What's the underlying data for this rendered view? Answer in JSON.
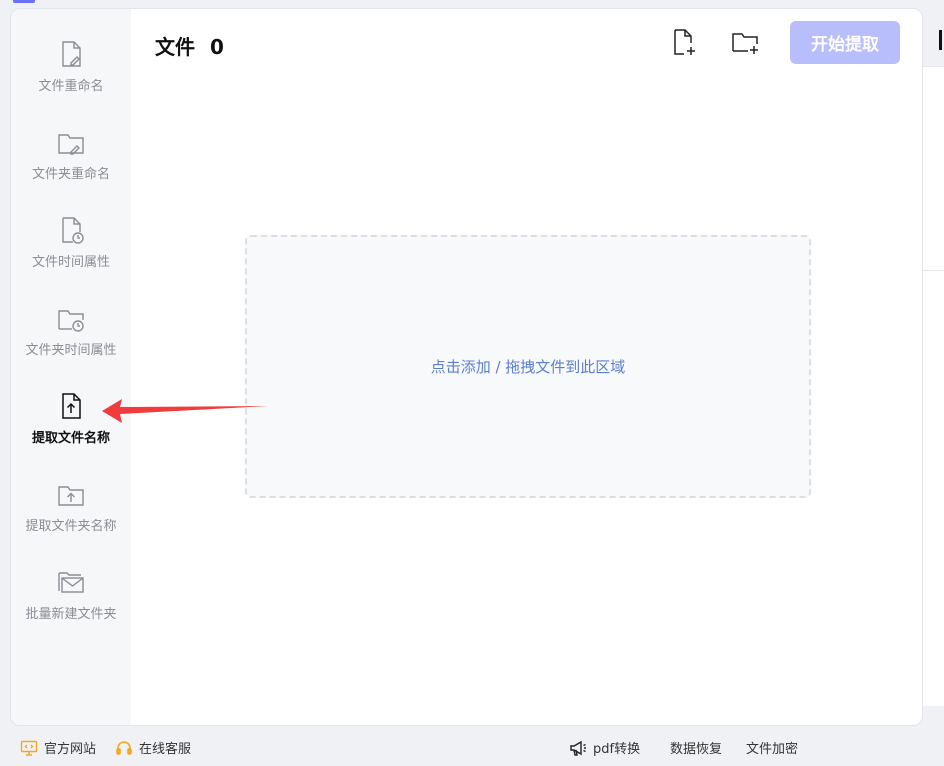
{
  "sidebar": {
    "items": [
      {
        "label": "文件重命名",
        "icon": "file-edit-icon",
        "active": false
      },
      {
        "label": "文件夹重命名",
        "icon": "folder-edit-icon",
        "active": false
      },
      {
        "label": "文件时间属性",
        "icon": "file-clock-icon",
        "active": false
      },
      {
        "label": "文件夹时间属性",
        "icon": "folder-clock-icon",
        "active": false
      },
      {
        "label": "提取文件名称",
        "icon": "file-upload-icon",
        "active": true
      },
      {
        "label": "提取文件夹名称",
        "icon": "folder-upload-icon",
        "active": false
      },
      {
        "label": "批量新建文件夹",
        "icon": "folder-mail-icon",
        "active": false
      }
    ]
  },
  "header": {
    "title_prefix": "文件",
    "file_count": "0",
    "add_file_icon": "file-plus-icon",
    "add_folder_icon": "folder-plus-icon",
    "start_label": "开始提取"
  },
  "dropzone": {
    "text": "点击添加 / 拖拽文件到此区域"
  },
  "footer": {
    "website": "官方网站",
    "support": "在线客服",
    "pdf": "pdf转换",
    "recovery": "数据恢复",
    "encrypt": "文件加密"
  },
  "colors": {
    "accent": "#b8bdfb",
    "link": "#5b7fd0",
    "arrow": "#f03c3c",
    "footer_icon": "#f5a623"
  }
}
